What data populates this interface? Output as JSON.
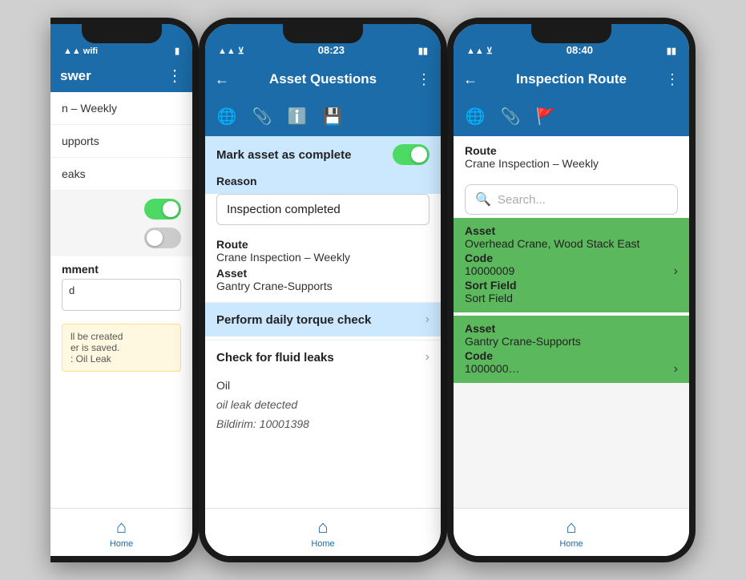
{
  "left_phone": {
    "status_time": "",
    "header": {
      "title": "swer",
      "menu_icon": "⋮"
    },
    "items": [
      "n – Weekly",
      "upports",
      "eaks"
    ],
    "toggles": [
      {
        "state": "on"
      },
      {
        "state": "off"
      }
    ],
    "comment_label": "mment",
    "comment_value": "d",
    "notification": "ll be created\ner is saved.\n: Oil Leak",
    "nav_label": "Home"
  },
  "middle_phone": {
    "status_time": "08:23",
    "header": {
      "back_icon": "←",
      "title": "Asset Questions",
      "menu_icon": "⋮"
    },
    "icons": [
      "🌐",
      "📎",
      "ℹ️",
      "💾"
    ],
    "toggle_label": "Mark asset as complete",
    "toggle_state": "on",
    "reason_label": "Reason",
    "reason_value": "Inspection completed",
    "route_label": "Route",
    "route_value": "Crane Inspection – Weekly",
    "asset_label": "Asset",
    "asset_value": "Gantry Crane-Supports",
    "list_items": [
      {
        "text": "Perform daily torque check",
        "highlighted": true,
        "has_chevron": true
      },
      {
        "text": "Check for fluid leaks",
        "highlighted": false,
        "has_chevron": true
      }
    ],
    "sub_items": [
      {
        "text": "Oil",
        "italic": false
      },
      {
        "text": "oil leak detected",
        "italic": true
      },
      {
        "text": "Bildirim: 10001398",
        "italic": true
      }
    ],
    "nav_label": "Home"
  },
  "right_phone": {
    "status_time": "08:40",
    "header": {
      "back_icon": "←",
      "title": "Inspection Route",
      "menu_icon": "⋮"
    },
    "icons": [
      "🌐",
      "📎",
      "🚩"
    ],
    "route_label": "Route",
    "route_value": "Crane Inspection – Weekly",
    "search_placeholder": "Search...",
    "assets": [
      {
        "asset_label": "Asset",
        "asset_value": "Overhead Crane, Wood Stack East",
        "code_label": "Code",
        "code_value": "10000009",
        "sort_label": "Sort Field",
        "sort_value": "Sort Field",
        "has_chevron": true
      },
      {
        "asset_label": "Asset",
        "asset_value": "Gantry Crane-Supports",
        "code_label": "Code",
        "code_value": "1000000…",
        "has_chevron": true
      }
    ],
    "nav_label": "Home"
  }
}
